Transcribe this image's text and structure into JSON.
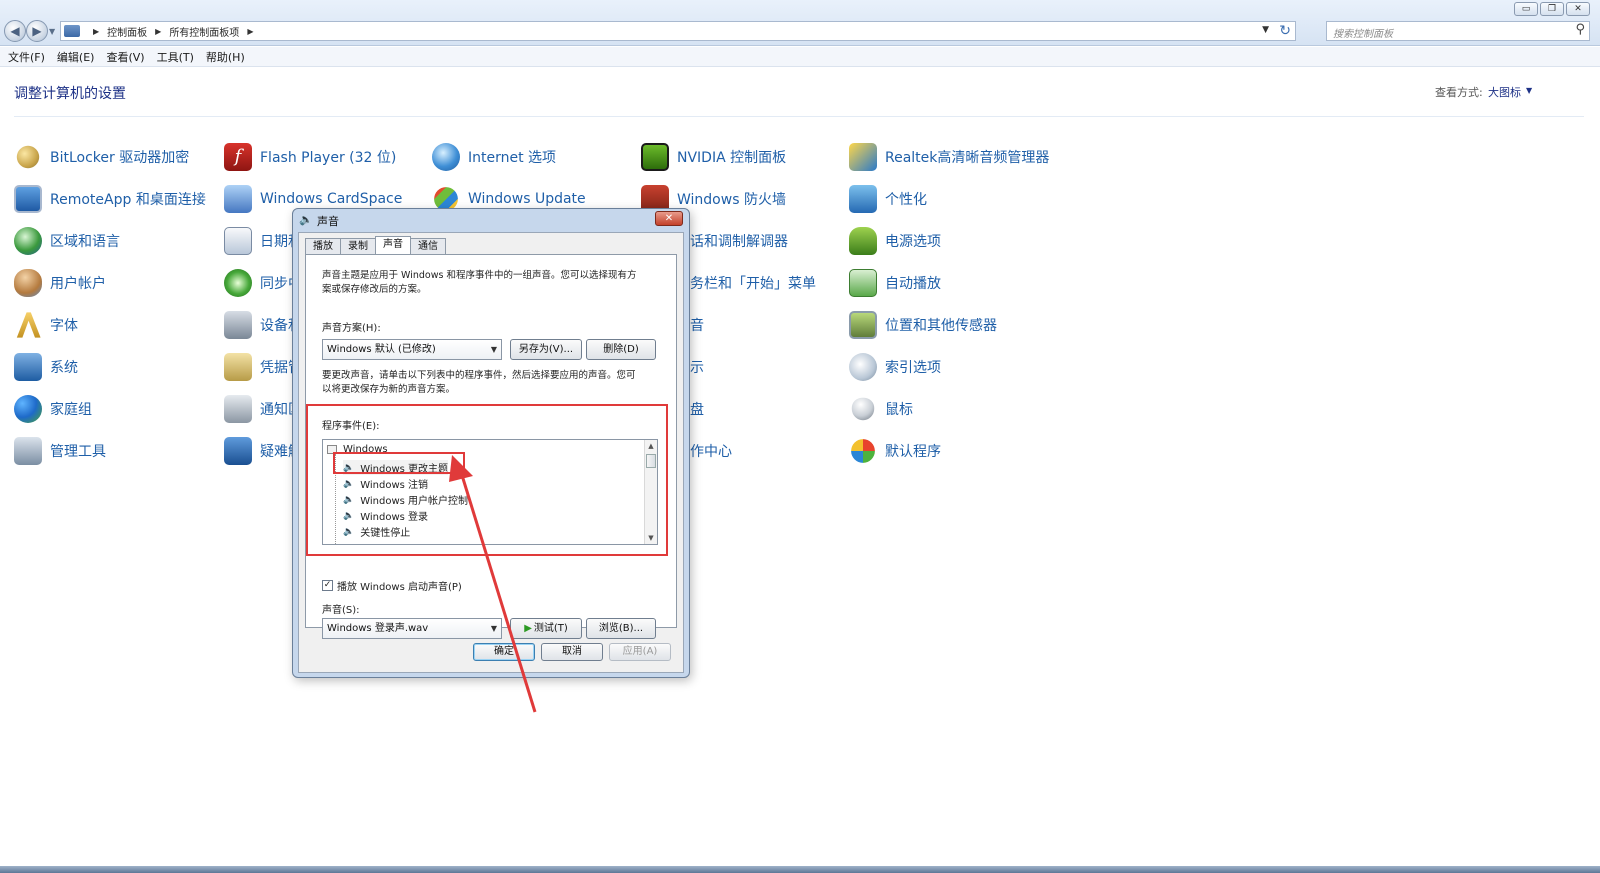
{
  "window": {
    "breadcrumbs": [
      "控制面板",
      "所有控制面板项"
    ],
    "search_placeholder": "搜索控制面板",
    "menu": [
      "文件(F)",
      "编辑(E)",
      "查看(V)",
      "工具(T)",
      "帮助(H)"
    ]
  },
  "header": {
    "title": "调整计算机的设置",
    "view_label": "查看方式:",
    "view_value": "大图标"
  },
  "items": {
    "col1": [
      "BitLocker 驱动器加密",
      "RemoteApp 和桌面连接",
      "区域和语言",
      "用户帐户",
      "字体",
      "系统",
      "家庭组",
      "管理工具"
    ],
    "col2": [
      "Flash Player (32 位)",
      "Windows CardSpace",
      "日期和",
      "同步中",
      "设备和",
      "凭据管",
      "通知区",
      "疑难解"
    ],
    "col3": [
      "Internet 选项",
      "Windows Update"
    ],
    "col4": [
      "NVIDIA 控制面板",
      "Windows 防火墙",
      "话和调制解调器",
      "务栏和「开始」菜单",
      "音",
      "示",
      "盘",
      "作中心"
    ],
    "col5": [
      "Realtek高清晰音频管理器",
      "个性化",
      "电源选项",
      "自动播放",
      "位置和其他传感器",
      "索引选项",
      "鼠标",
      "默认程序"
    ]
  },
  "dialog": {
    "title": "声音",
    "tabs": [
      "播放",
      "录制",
      "声音",
      "通信"
    ],
    "active_tab": "声音",
    "desc1_line1": "声音主题是应用于 Windows 和程序事件中的一组声音。您可以选择现有方",
    "desc1_line2": "案或保存修改后的方案。",
    "scheme_label": "声音方案(H):",
    "scheme_value": "Windows 默认 (已修改)",
    "save_as": "另存为(V)...",
    "delete": "删除(D)",
    "desc2_line1": "要更改声音，请单击以下列表中的程序事件，然后选择要应用的声音。您可",
    "desc2_line2": "以将更改保存为新的声音方案。",
    "events_label": "程序事件(E):",
    "tree_root": "Windows",
    "events": [
      "Windows 更改主题",
      "Windows 注销",
      "Windows 用户帐户控制",
      "Windows 登录",
      "关键性停止"
    ],
    "play_startup": "播放 Windows 启动声音(P)",
    "sound_label": "声音(S):",
    "sound_value": "Windows 登录声.wav",
    "test": "测试(T)",
    "browse": "浏览(B)...",
    "ok": "确定",
    "cancel": "取消",
    "apply": "应用(A)"
  },
  "colors": {
    "link": "#1f5fa8",
    "title": "#1e3287",
    "annotation": "#e03a3a"
  }
}
